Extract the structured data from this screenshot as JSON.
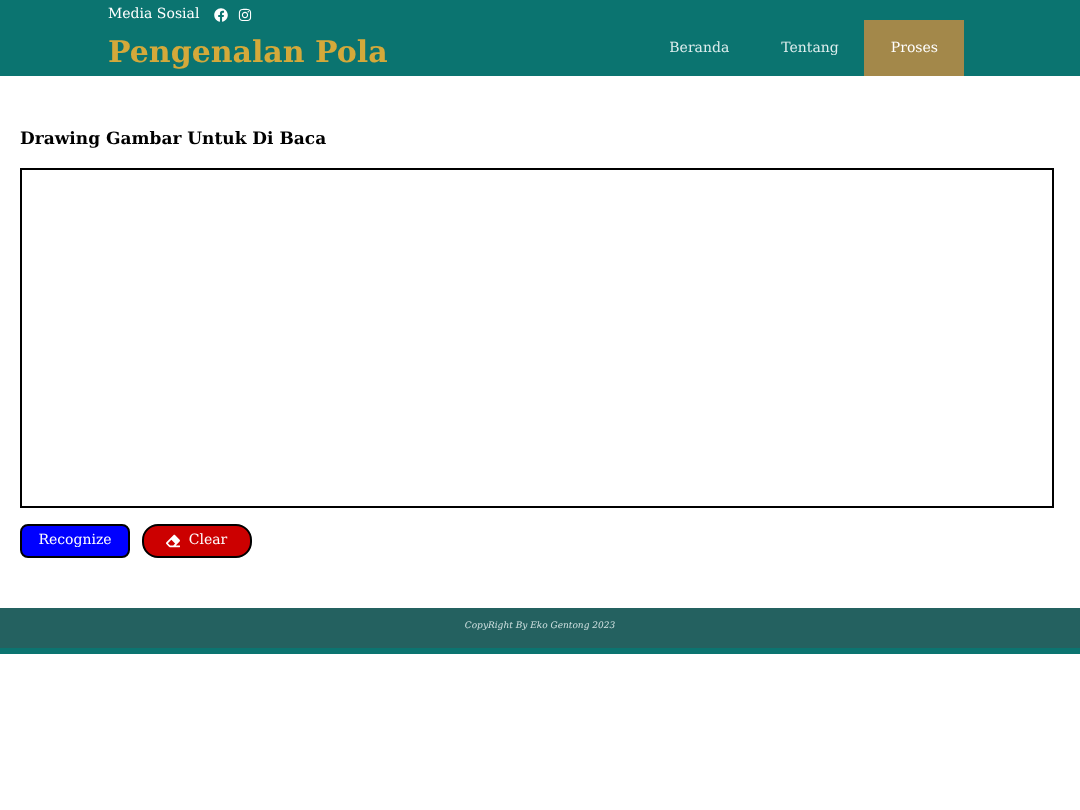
{
  "header": {
    "social_label": "Media Sosial",
    "brand": "Pengenalan Pola",
    "nav": [
      {
        "label": "Beranda",
        "selected": false
      },
      {
        "label": "Tentang",
        "selected": false
      },
      {
        "label": "Proses",
        "selected": true
      }
    ]
  },
  "section": {
    "title": "Drawing Gambar Untuk Di Baca"
  },
  "buttons": [
    {
      "label": "Recognize",
      "kind": "primary"
    },
    {
      "label": "Clear",
      "kind": "danger"
    }
  ],
  "footer": {
    "text": "CopyRight By Eko Gentong 2023"
  }
}
